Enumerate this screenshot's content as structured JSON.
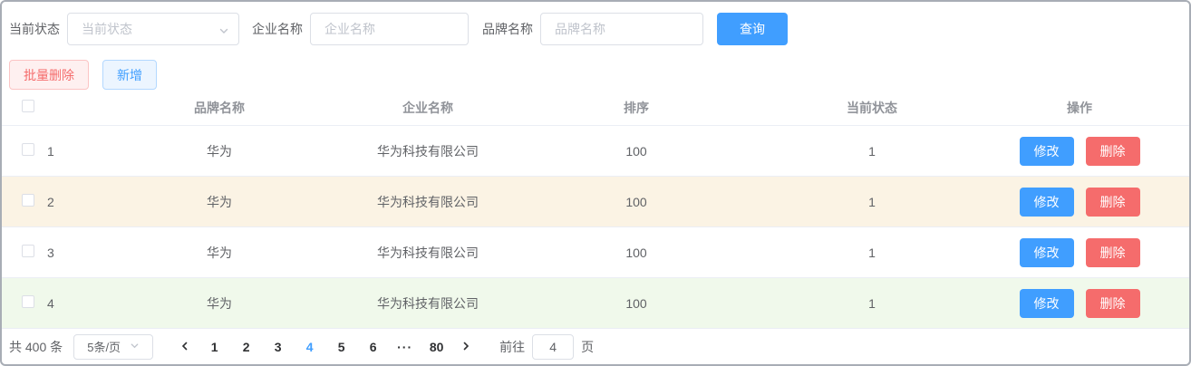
{
  "filter_bar": {
    "status": {
      "label": "当前状态",
      "placeholder": "当前状态"
    },
    "enterprise": {
      "label": "企业名称",
      "placeholder": "企业名称"
    },
    "brand": {
      "label": "品牌名称",
      "placeholder": "品牌名称"
    },
    "search_button": "查询"
  },
  "action_bar": {
    "batch_delete_button": "批量删除",
    "add_button": "新增"
  },
  "table": {
    "headers": {
      "brand": "品牌名称",
      "enterprise": "企业名称",
      "sort": "排序",
      "status": "当前状态",
      "operations": "操作"
    },
    "rows": [
      {
        "index": "1",
        "brand": "华为",
        "enterprise": "华为科技有限公司",
        "sort": "100",
        "status": "1",
        "highlight": "none",
        "checked": false
      },
      {
        "index": "2",
        "brand": "华为",
        "enterprise": "华为科技有限公司",
        "sort": "100",
        "status": "1",
        "highlight": "warning",
        "checked": false
      },
      {
        "index": "3",
        "brand": "华为",
        "enterprise": "华为科技有限公司",
        "sort": "100",
        "status": "1",
        "highlight": "none",
        "checked": false
      },
      {
        "index": "4",
        "brand": "华为",
        "enterprise": "华为科技有限公司",
        "sort": "100",
        "status": "1",
        "highlight": "success",
        "checked": false
      }
    ],
    "row_buttons": {
      "edit": "修改",
      "delete": "删除"
    }
  },
  "pagination": {
    "total_text": "共 400 条",
    "page_size": "5条/页",
    "pages": [
      "1",
      "2",
      "3",
      "4",
      "5",
      "6",
      "···",
      "80"
    ],
    "active_page": "4",
    "goto_label": "前往",
    "goto_value": "4",
    "page_unit": "页"
  },
  "colors": {
    "primary": "#409EFF",
    "danger": "#F56C6C",
    "warning_row_bg": "#FBF3E4",
    "success_row_bg": "#F0F9EB",
    "header_text": "#909399",
    "body_text": "#606266",
    "input_border": "#DCDFE6"
  },
  "icons": {
    "select_chevron": "chevron-down",
    "pager_prev": "chevron-left",
    "pager_next": "chevron-right",
    "pager_more": "ellipsis-dots"
  }
}
